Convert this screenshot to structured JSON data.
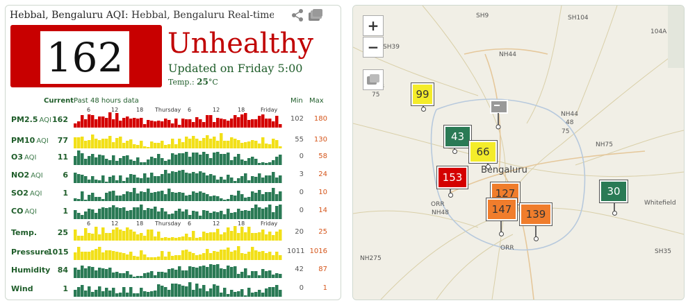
{
  "header": {
    "title_strong": "Hebbal, Bengaluru AQI:",
    "title_rest": " Hebbal, Bengaluru Real-time Air Q"
  },
  "aqi": {
    "value": "162",
    "status": "Unhealthy",
    "updated": "Updated on Friday 5:00",
    "temp_label": "Temp.:",
    "temp_value": "25",
    "temp_unit": "°C",
    "color": "#c80000"
  },
  "table": {
    "current_header": "Current",
    "past_header": "Past 48 hours data",
    "min_header": "Min",
    "max_header": "Max",
    "axis_ticks": [
      "6",
      "12",
      "18",
      "Thursday",
      "6",
      "12",
      "18",
      "Friday"
    ],
    "rows": [
      {
        "name": "PM2.5",
        "unit": "AQI",
        "current": "162",
        "min": "102",
        "max": "180",
        "color": "#d40000"
      },
      {
        "name": "PM10",
        "unit": "AQI",
        "current": "77",
        "min": "55",
        "max": "130",
        "color": "#f2e018"
      },
      {
        "name": "O3",
        "unit": "AQI",
        "current": "11",
        "min": "0",
        "max": "58",
        "color": "#2a7a55"
      },
      {
        "name": "NO2",
        "unit": "AQI",
        "current": "6",
        "min": "3",
        "max": "24",
        "color": "#2a7a55"
      },
      {
        "name": "SO2",
        "unit": "AQI",
        "current": "1",
        "min": "0",
        "max": "10",
        "color": "#2a7a55"
      },
      {
        "name": "CO",
        "unit": "AQI",
        "current": "1",
        "min": "0",
        "max": "14",
        "color": "#2a7a55"
      },
      {
        "name": "Temp.",
        "unit": "",
        "current": "25",
        "min": "20",
        "max": "25",
        "color": "#f2e018"
      },
      {
        "name": "Pressure",
        "unit": "",
        "current": "1015",
        "min": "1011",
        "max": "1016",
        "color": "#f2e018"
      },
      {
        "name": "Humidity",
        "unit": "",
        "current": "84",
        "min": "42",
        "max": "87",
        "color": "#2a7a55"
      },
      {
        "name": "Wind",
        "unit": "",
        "current": "1",
        "min": "0",
        "max": "1",
        "color": "#2a7a55"
      }
    ]
  },
  "map": {
    "zoom_in": "+",
    "zoom_out": "−",
    "city_name": "Bengaluru",
    "labels": [
      "SH9",
      "SH104",
      "104A",
      "SH39",
      "NH44",
      "NH48",
      "75",
      "NH44",
      "48",
      "75",
      "NH75",
      "Whitefield",
      "ORR",
      "NH48",
      "ORR",
      "NH275",
      "SH35"
    ],
    "stations": [
      {
        "value": "99",
        "color": "#f4ec2a",
        "text": "#333"
      },
      {
        "value": "43",
        "color": "#2a7a55",
        "text": "#fff"
      },
      {
        "value": "66",
        "color": "#f4ec2a",
        "text": "#333"
      },
      {
        "value": "153",
        "color": "#d40000",
        "text": "#fff"
      },
      {
        "value": "127",
        "color": "#f07d2c",
        "text": "#333"
      },
      {
        "value": "147",
        "color": "#f07d2c",
        "text": "#333"
      },
      {
        "value": "139",
        "color": "#f07d2c",
        "text": "#333"
      },
      {
        "value": "30",
        "color": "#2a7a55",
        "text": "#fff"
      }
    ]
  }
}
